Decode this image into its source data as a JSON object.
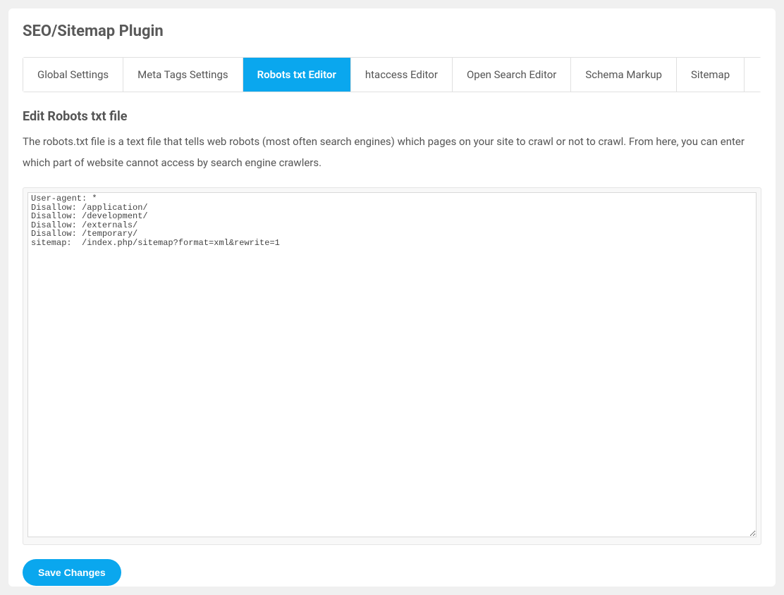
{
  "header": {
    "title": "SEO/Sitemap Plugin"
  },
  "tabs": {
    "items": [
      {
        "label": "Global Settings",
        "active": false
      },
      {
        "label": "Meta Tags Settings",
        "active": false
      },
      {
        "label": "Robots txt Editor",
        "active": true
      },
      {
        "label": "htaccess Editor",
        "active": false
      },
      {
        "label": "Open Search Editor",
        "active": false
      },
      {
        "label": "Schema Markup",
        "active": false
      },
      {
        "label": "Sitemap",
        "active": false
      }
    ]
  },
  "section": {
    "title": "Edit Robots txt file",
    "description": "The robots.txt file is a text file that tells web robots (most often search engines) which pages on your site to crawl or not to crawl. From here, you can enter which part of website cannot access by search engine crawlers."
  },
  "editor": {
    "value": "User-agent: *\nDisallow: /application/\nDisallow: /development/\nDisallow: /externals/\nDisallow: /temporary/\nsitemap:  /index.php/sitemap?format=xml&rewrite=1"
  },
  "actions": {
    "save_label": "Save Changes"
  }
}
